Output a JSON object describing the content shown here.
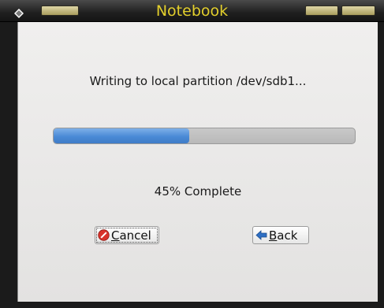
{
  "window": {
    "title": "Notebook"
  },
  "dialog": {
    "message": "Writing to local partition /dev/sdb1...",
    "progress": {
      "percent": 45,
      "status_text": "45% Complete"
    },
    "buttons": {
      "cancel": {
        "mnemonic": "C",
        "rest": "ancel",
        "icon": "cancel-icon"
      },
      "back": {
        "mnemonic": "B",
        "rest": "ack",
        "icon": "back-arrow-icon"
      }
    }
  },
  "colors": {
    "title_text": "#e3cf2c",
    "progress_fill": "#4a8ad6",
    "cancel_icon": "#d8322a",
    "back_icon": "#2f6fc4"
  }
}
